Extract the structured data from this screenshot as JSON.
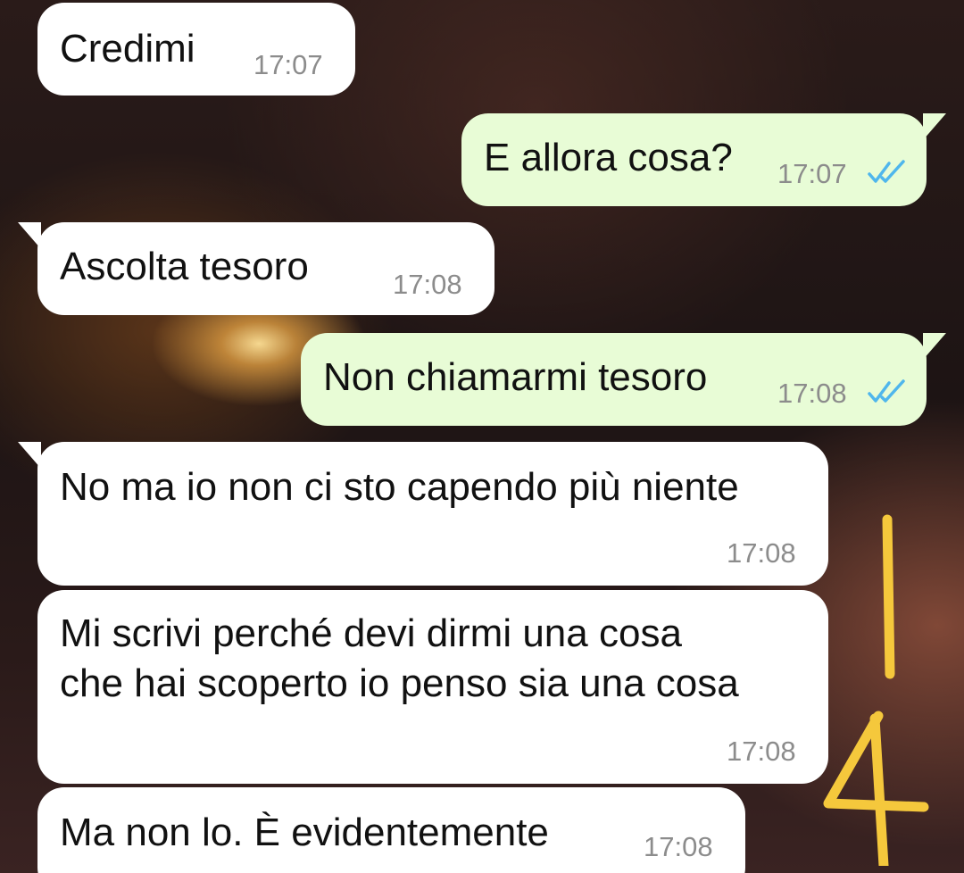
{
  "messages": [
    {
      "direction": "in",
      "text": "Credimi",
      "time": "17:07"
    },
    {
      "direction": "out",
      "text": "E allora cosa?",
      "time": "17:07",
      "status": "read"
    },
    {
      "direction": "in",
      "text": "Ascolta tesoro",
      "time": "17:08"
    },
    {
      "direction": "out",
      "text": "Non chiamarmi tesoro",
      "time": "17:08",
      "status": "read"
    },
    {
      "direction": "in",
      "text": "No ma io non ci sto capendo più niente",
      "time": "17:08"
    },
    {
      "direction": "in",
      "text": "Mi scrivi perché devi dirmi una cosa\nche hai scoperto io penso sia una cosa",
      "time": "17:08"
    },
    {
      "direction": "in",
      "text": "Ma non lo. È evidentemente",
      "time": "17:08"
    }
  ],
  "annotation": {
    "handwritten": "14",
    "color": "#f5c83c"
  },
  "colors": {
    "incoming": "#ffffff",
    "outgoing": "#e8fcd6",
    "read_ticks": "#4fb6ec",
    "timestamp": "#8c8c8c"
  }
}
